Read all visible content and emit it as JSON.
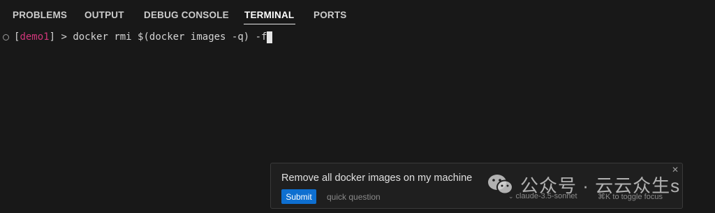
{
  "tabs": [
    {
      "label": "PROBLEMS",
      "active": false
    },
    {
      "label": "OUTPUT",
      "active": false
    },
    {
      "label": "DEBUG CONSOLE",
      "active": false
    },
    {
      "label": "TERMINAL",
      "active": true
    },
    {
      "label": "PORTS",
      "active": false
    }
  ],
  "terminal": {
    "status_icon": "circle-icon",
    "bracket_open": "[",
    "env_name": "demo1",
    "bracket_close": "]",
    "prompt_symbol": " > ",
    "command": "docker rmi $(docker images -q) -f"
  },
  "ask_box": {
    "query": "Remove all docker images on my machine",
    "submit_label": "Submit",
    "quick_question_label": "quick question",
    "model_label": "claude-3.5-sonnet",
    "toggle_hint": "⌘K to toggle focus",
    "close_icon": "close-icon"
  },
  "watermark": {
    "text": "公众号 · 云云众生s"
  },
  "colors": {
    "background": "#181818",
    "env_name": "#d0367a",
    "submit_button": "#0e6fd0",
    "active_tab_underline": "#e7e7e7"
  }
}
